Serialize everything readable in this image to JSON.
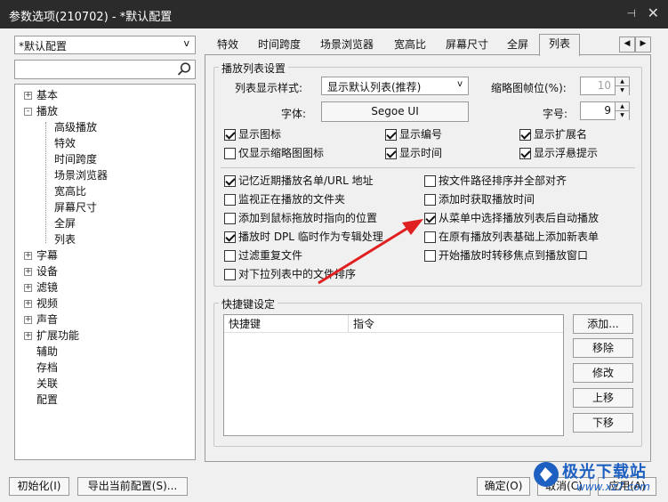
{
  "window": {
    "title": "参数选项(210702) - *默认配置",
    "pin_glyph": "⊣",
    "close_glyph": "✕"
  },
  "profile": {
    "selected": "*默认配置"
  },
  "search": {
    "placeholder": ""
  },
  "tree": {
    "items": [
      {
        "label": "基本",
        "level": 0,
        "expander": "+"
      },
      {
        "label": "播放",
        "level": 0,
        "expander": "-"
      },
      {
        "label": "高级播放",
        "level": 1
      },
      {
        "label": "特效",
        "level": 1
      },
      {
        "label": "时间跨度",
        "level": 1
      },
      {
        "label": "场景浏览器",
        "level": 1
      },
      {
        "label": "宽高比",
        "level": 1
      },
      {
        "label": "屏幕尺寸",
        "level": 1
      },
      {
        "label": "全屏",
        "level": 1
      },
      {
        "label": "列表",
        "level": 1
      },
      {
        "label": "字幕",
        "level": 0,
        "expander": "+"
      },
      {
        "label": "设备",
        "level": 0,
        "expander": "+"
      },
      {
        "label": "滤镜",
        "level": 0,
        "expander": "+"
      },
      {
        "label": "视频",
        "level": 0,
        "expander": "+"
      },
      {
        "label": "声音",
        "level": 0,
        "expander": "+"
      },
      {
        "label": "扩展功能",
        "level": 0,
        "expander": "+"
      },
      {
        "label": "辅助",
        "level": 0
      },
      {
        "label": "存档",
        "level": 0
      },
      {
        "label": "关联",
        "level": 0
      },
      {
        "label": "配置",
        "level": 0
      }
    ]
  },
  "tabs": [
    {
      "label": "特效"
    },
    {
      "label": "时间跨度"
    },
    {
      "label": "场景浏览器"
    },
    {
      "label": "宽高比"
    },
    {
      "label": "屏幕尺寸"
    },
    {
      "label": "全屏"
    },
    {
      "label": "列表",
      "active": true
    }
  ],
  "playlist_settings": {
    "group_title": "播放列表设置",
    "style_label": "列表显示样式:",
    "style_value": "显示默认列表(推荐)",
    "thumb_fps_label": "缩略图帧位(%):",
    "thumb_fps_value": "10",
    "font_label": "字体:",
    "font_value": "Segoe UI",
    "size_label": "字号:",
    "size_value": "9",
    "checks_row1": [
      {
        "label": "显示图标",
        "checked": true
      },
      {
        "label": "显示编号",
        "checked": true
      },
      {
        "label": "显示扩展名",
        "checked": true
      }
    ],
    "checks_row2": [
      {
        "label": "仅显示缩略图图标",
        "checked": false
      },
      {
        "label": "显示时间",
        "checked": true
      },
      {
        "label": "显示浮悬提示",
        "checked": true
      }
    ],
    "checks_left": [
      {
        "label": "记忆近期播放名单/URL 地址",
        "checked": true
      },
      {
        "label": "监视正在播放的文件夹",
        "checked": false
      },
      {
        "label": "添加到鼠标拖放时指向的位置",
        "checked": false
      },
      {
        "label": "播放时 DPL 临时作为专辑处理",
        "checked": true
      },
      {
        "label": "过滤重复文件",
        "checked": false
      },
      {
        "label": "对下拉列表中的文件排序",
        "checked": false
      }
    ],
    "checks_right": [
      {
        "label": "按文件路径排序并全部对齐",
        "checked": false
      },
      {
        "label": "添加时获取播放时间",
        "checked": false
      },
      {
        "label": "从菜单中选择播放列表后自动播放",
        "checked": true
      },
      {
        "label": "在原有播放列表基础上添加新表单",
        "checked": false
      },
      {
        "label": "开始播放时转移焦点到播放窗口",
        "checked": false
      }
    ]
  },
  "shortcuts": {
    "group_title": "快捷键设定",
    "columns": [
      "快捷键",
      "指令"
    ],
    "buttons": {
      "add": "添加...",
      "remove": "移除",
      "edit": "修改",
      "up": "上移",
      "down": "下移"
    }
  },
  "footer": {
    "init": "初始化(I)",
    "export": "导出当前配置(S)...",
    "ok": "确定(O)",
    "cancel": "取消(C)",
    "apply": "应用(A)"
  },
  "watermark": {
    "text": "极光下载站",
    "url": "www.xz7.com"
  },
  "colors": {
    "titlebar": "#2b2b2b",
    "arrow": "#e02020",
    "watermark": "#1e5fc2"
  }
}
